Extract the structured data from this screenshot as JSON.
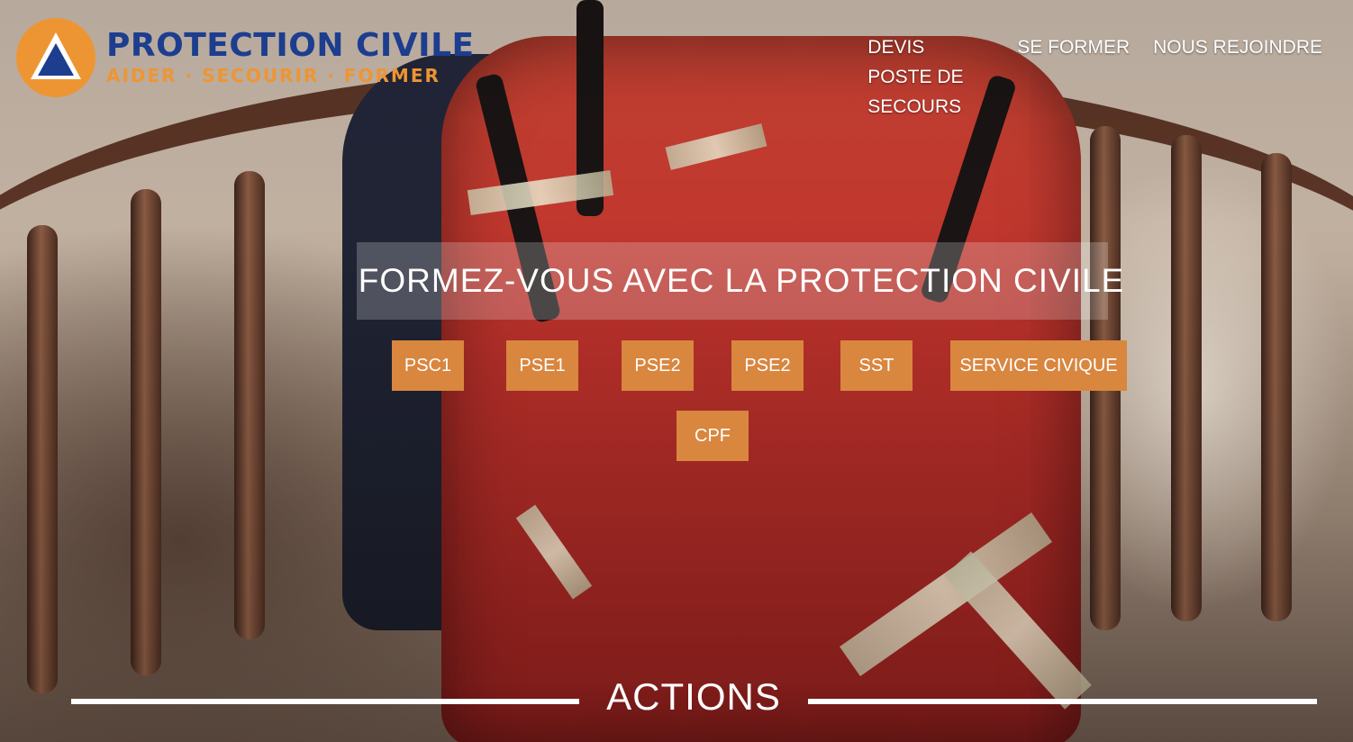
{
  "brand": {
    "name": "PROTECTION CIVILE",
    "tagline": "AIDER · SECOURIR · FORMER",
    "colors": {
      "blue": "#1d3d8f",
      "orange": "#ee9533"
    }
  },
  "nav": {
    "items": [
      {
        "label": "DEVIS POSTE DE SECOURS"
      },
      {
        "label": "SE FORMER"
      },
      {
        "label": "NOUS REJOINDRE"
      }
    ]
  },
  "hero": {
    "title": "FORMEZ-VOUS AVEC LA PROTECTION CIVILE",
    "buttons": [
      {
        "label": "PSC1"
      },
      {
        "label": "PSE1"
      },
      {
        "label": "PSE2"
      },
      {
        "label": "PSE2"
      },
      {
        "label": "SST"
      },
      {
        "label": "SERVICE CIVIQUE"
      },
      {
        "label": "CPF"
      }
    ],
    "button_color": "#d9863f"
  },
  "actions": {
    "title": "ACTIONS"
  }
}
